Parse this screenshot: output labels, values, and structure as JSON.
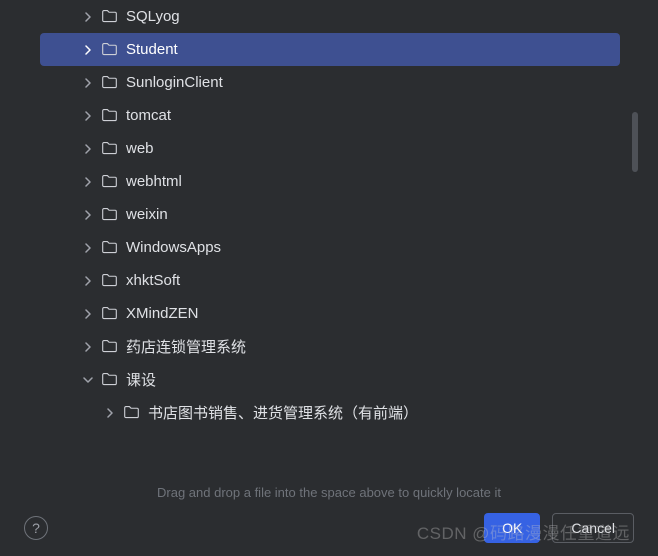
{
  "tree": {
    "items": [
      {
        "label": "SQLyog",
        "depth": 1,
        "expanded": false,
        "selected": false
      },
      {
        "label": "Student",
        "depth": 1,
        "expanded": false,
        "selected": true
      },
      {
        "label": "SunloginClient",
        "depth": 1,
        "expanded": false,
        "selected": false
      },
      {
        "label": "tomcat",
        "depth": 1,
        "expanded": false,
        "selected": false
      },
      {
        "label": "web",
        "depth": 1,
        "expanded": false,
        "selected": false
      },
      {
        "label": "webhtml",
        "depth": 1,
        "expanded": false,
        "selected": false
      },
      {
        "label": "weixin",
        "depth": 1,
        "expanded": false,
        "selected": false
      },
      {
        "label": "WindowsApps",
        "depth": 1,
        "expanded": false,
        "selected": false
      },
      {
        "label": "xhktSoft",
        "depth": 1,
        "expanded": false,
        "selected": false
      },
      {
        "label": "XMindZEN",
        "depth": 1,
        "expanded": false,
        "selected": false
      },
      {
        "label": "药店连锁管理系统",
        "depth": 1,
        "expanded": false,
        "selected": false
      },
      {
        "label": "课设",
        "depth": 1,
        "expanded": true,
        "selected": false
      },
      {
        "label": "书店图书销售、进货管理系统（有前端）",
        "depth": 2,
        "expanded": false,
        "selected": false
      }
    ]
  },
  "hint": "Drag and drop a file into the space above to quickly locate it",
  "buttons": {
    "ok": "OK",
    "cancel": "Cancel",
    "help": "?"
  },
  "watermark": "CSDN @码路漫漫任重道远",
  "icons": {
    "chevron_right": "chevron-right",
    "chevron_down": "chevron-down",
    "folder": "folder"
  }
}
